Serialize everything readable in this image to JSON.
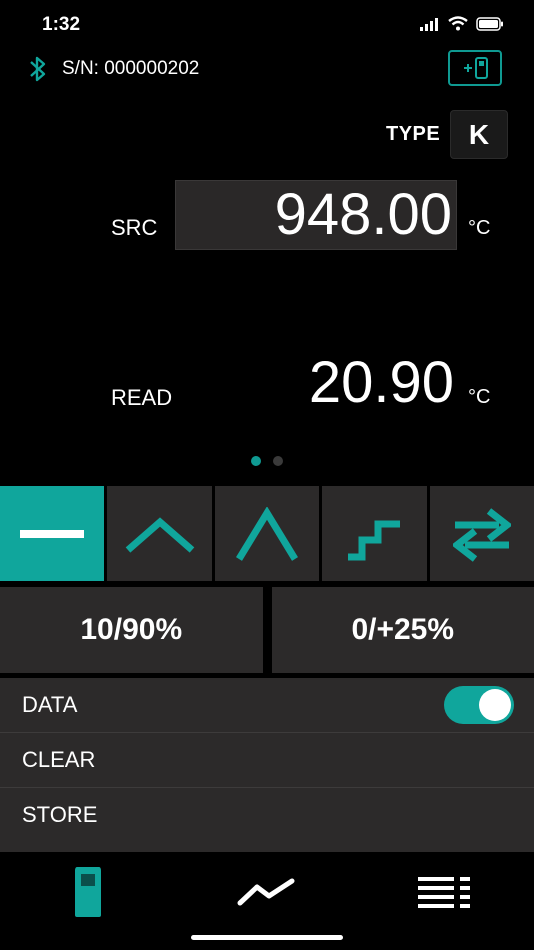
{
  "status": {
    "time": "1:32"
  },
  "header": {
    "serial_label": "S/N: 000000202"
  },
  "type": {
    "label": "TYPE",
    "value": "K"
  },
  "source": {
    "label": "SRC",
    "value": "948.00",
    "unit": "°C"
  },
  "reading": {
    "label": "READ",
    "value": "20.90",
    "unit": "°C"
  },
  "pager": {
    "count": 2,
    "active_index": 0
  },
  "waveforms": {
    "items": [
      {
        "icon": "flat-line-icon"
      },
      {
        "icon": "triangle-ramp-icon"
      },
      {
        "icon": "peak-ramp-icon"
      },
      {
        "icon": "staircase-step-icon"
      },
      {
        "icon": "swap-arrows-icon"
      }
    ],
    "selected_index": 0
  },
  "presets": {
    "left_label": "10/90%",
    "right_label": "0/+25%"
  },
  "list": {
    "data_label": "DATA",
    "data_toggle_on": true,
    "clear_label": "CLEAR",
    "store_label": "STORE"
  },
  "tabbar": {
    "tabs": [
      "device-icon",
      "trend-chart-icon",
      "menu-list-icon"
    ],
    "active_index": 0
  },
  "colors": {
    "accent": "#10a69c",
    "panel": "#2c2a2a",
    "background": "#000000"
  }
}
